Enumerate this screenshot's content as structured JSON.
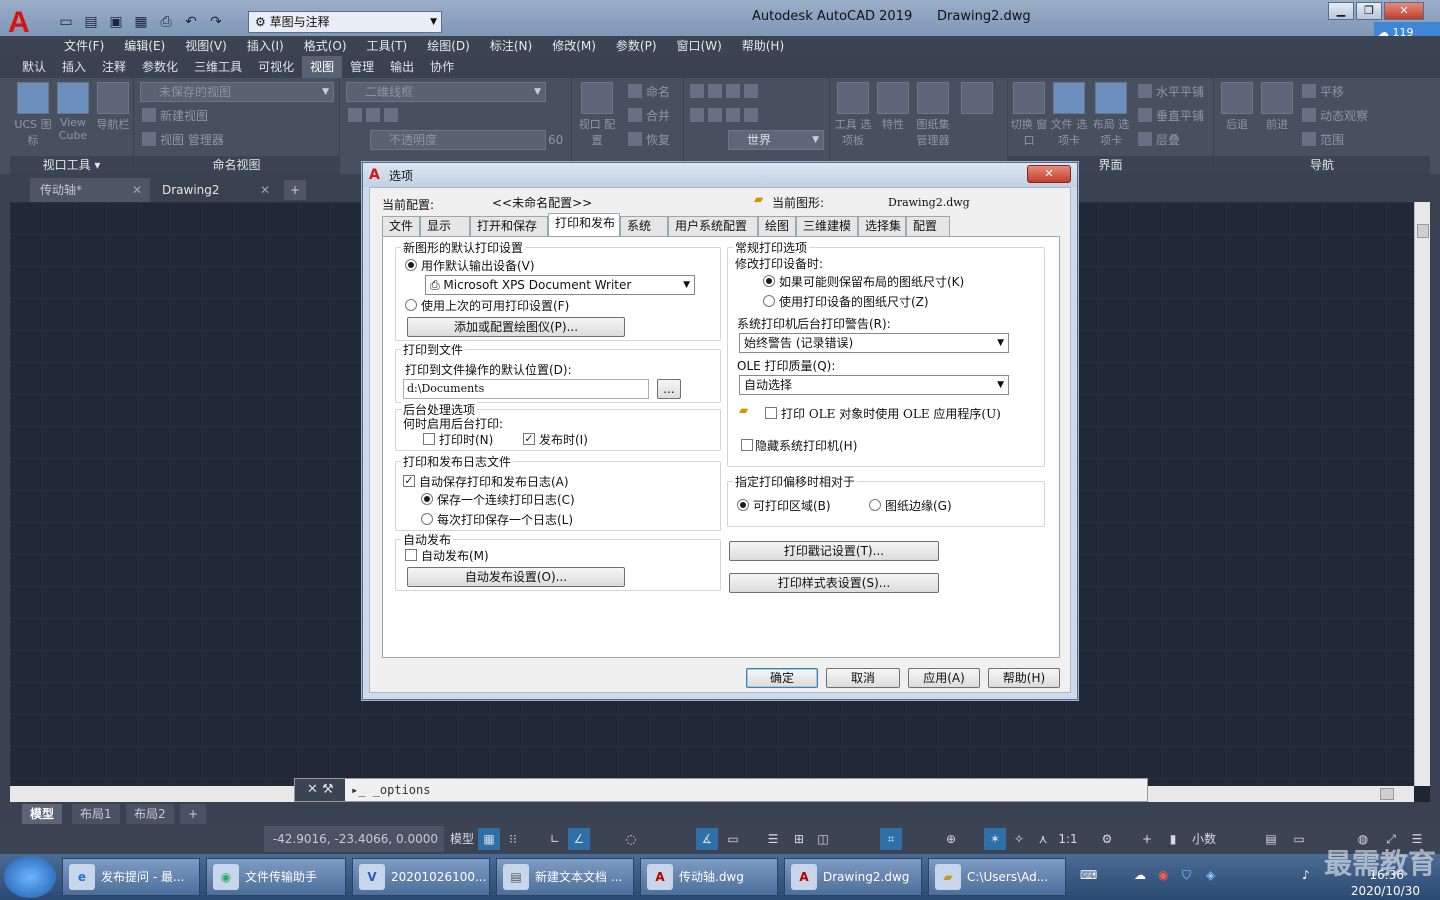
{
  "app": {
    "logo": "A",
    "title": "Autodesk AutoCAD 2019      Drawing2.dwg",
    "workspace": "草图与注释",
    "cloud_badge": "119"
  },
  "quick_access": [
    "new-icon",
    "open-icon",
    "save-icon",
    "save-as-icon",
    "print-icon",
    "undo-icon",
    "redo-icon"
  ],
  "menu": [
    "文件(F)",
    "编辑(E)",
    "视图(V)",
    "插入(I)",
    "格式(O)",
    "工具(T)",
    "绘图(D)",
    "标注(N)",
    "修改(M)",
    "参数(P)",
    "窗口(W)",
    "帮助(H)"
  ],
  "ribbon_tabs": [
    "默认",
    "插入",
    "注释",
    "参数化",
    "三维工具",
    "可视化",
    "视图",
    "管理",
    "输出",
    "协作"
  ],
  "ribbon_active_tab": "视图",
  "ribbon": {
    "groups": {
      "viewport_tools": "视口工具 ▾",
      "named_views": "命名视图",
      "interface": "界面",
      "navigation": "导航"
    },
    "buttons": {
      "ucs_icon": "UCS 图标",
      "view_cube": "View Cube",
      "nav_bar": "导航栏",
      "unsaved_view": "未保存的视图",
      "new_view": "新建视图",
      "view_manager": "视图 管理器",
      "visual_style": "二维线框",
      "opacity": "不透明度",
      "opacity_value": "60",
      "viewport_config": "视口 配置",
      "merge": "合并",
      "name": "命名",
      "restore": "恢复",
      "world": "世界",
      "tool_palettes": "工具 选项板",
      "properties": "特性",
      "sheet_set": "图纸集 管理器",
      "switch_window": "切换 窗口",
      "file_tabs": "文件 选项卡",
      "layout_tabs": "布局 选项卡",
      "tile_h": "水平平铺",
      "tile_v": "垂直平铺",
      "cascade": "层叠",
      "back": "后退",
      "forward": "前进",
      "pan": "平移",
      "orbit": "动态观察",
      "extents": "范围"
    }
  },
  "doc_tabs": [
    {
      "label": "传动轴*",
      "active": false
    },
    {
      "label": "Drawing2",
      "active": true
    }
  ],
  "command_line": {
    "prompt": "_options"
  },
  "layout_tabs": [
    "模型",
    "布局1",
    "布局2"
  ],
  "status": {
    "coords": "-42.9016, -23.4066, 0.0000",
    "model": "模型",
    "scale": "1:1",
    "units": "小数"
  },
  "taskbar": [
    {
      "label": "发布提问 - 最...",
      "icon": "ie-icon"
    },
    {
      "label": "文件传输助手",
      "icon": "wechat-icon"
    },
    {
      "label": "20201026100...",
      "icon": "video-icon"
    },
    {
      "label": "新建文本文档 ...",
      "icon": "notepad-icon"
    },
    {
      "label": "传动轴.dwg",
      "icon": "autocad-icon"
    },
    {
      "label": "Drawing2.dwg",
      "icon": "autocad-icon"
    },
    {
      "label": "C:\\Users\\Ad...",
      "icon": "folder-icon"
    }
  ],
  "clock": {
    "time": "16:36",
    "date": "2020/10/30"
  },
  "watermark": "最需教育",
  "dialog": {
    "title": "选项",
    "current_profile_label": "当前配置:",
    "current_profile": "<<未命名配置>>",
    "current_drawing_label": "当前图形:",
    "current_drawing": "Drawing2.dwg",
    "tabs": [
      "文件",
      "显示",
      "打开和保存",
      "打印和发布",
      "系统",
      "用户系统配置",
      "绘图",
      "三维建模",
      "选择集",
      "配置"
    ],
    "active_tab": "打印和发布",
    "default_print": {
      "title": "新图形的默认打印设置",
      "use_default_device": "用作默认输出设备(V)",
      "device": "Microsoft XPS Document Writer",
      "use_last": "使用上次的可用打印设置(F)",
      "add_plotter": "添加或配置绘图仪(P)..."
    },
    "plot_to_file": {
      "title": "打印到文件",
      "location_label": "打印到文件操作的默认位置(D):",
      "location": "d:\\Documents",
      "browse": "..."
    },
    "background": {
      "title": "后台处理选项",
      "when_label": "何时启用后台打印:",
      "when_plotting": "打印时(N)",
      "when_publishing": "发布时(I)",
      "when_plotting_checked": false,
      "when_publishing_checked": true
    },
    "log": {
      "title": "打印和发布日志文件",
      "auto_save": "自动保存打印和发布日志(A)",
      "auto_save_checked": true,
      "continuous": "保存一个连续打印日志(C)",
      "per_plot": "每次打印保存一个日志(L)"
    },
    "auto_publish": {
      "title": "自动发布",
      "auto_publish": "自动发布(M)",
      "auto_publish_checked": false,
      "settings": "自动发布设置(O)..."
    },
    "general": {
      "title": "常规打印选项",
      "change_device_label": "修改打印设备时:",
      "keep_size": "如果可能则保留布局的图纸尺寸(K)",
      "use_device_size": "使用打印设备的图纸尺寸(Z)",
      "spooler_label": "系统打印机后台打印警告(R):",
      "spooler": "始终警告 (记录错误)",
      "ole_label": "OLE 打印质量(Q):",
      "ole": "自动选择",
      "ole_app": "打印 OLE 对象时使用 OLE 应用程序(U)",
      "ole_app_checked": false,
      "hide_printers": "隐藏系统打印机(H)",
      "hide_printers_checked": false
    },
    "offset": {
      "title": "指定打印偏移时相对于",
      "printable": "可打印区域(B)",
      "edge": "图纸边缘(G)"
    },
    "stamp": "打印戳记设置(T)...",
    "style": "打印样式表设置(S)...",
    "buttons": {
      "ok": "确定",
      "cancel": "取消",
      "apply": "应用(A)",
      "help": "帮助(H)"
    }
  }
}
